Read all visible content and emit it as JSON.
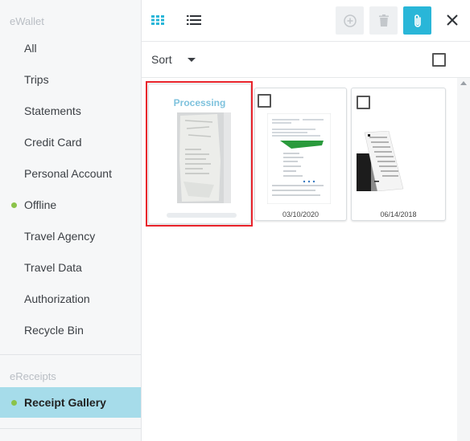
{
  "sidebar": {
    "ewallet_title": "eWallet",
    "items": [
      {
        "label": "All"
      },
      {
        "label": "Trips"
      },
      {
        "label": "Statements"
      },
      {
        "label": "Credit Card"
      },
      {
        "label": "Personal Account"
      },
      {
        "label": "Offline"
      },
      {
        "label": "Travel Agency"
      },
      {
        "label": "Travel Data"
      },
      {
        "label": "Authorization"
      },
      {
        "label": "Recycle Bin"
      }
    ],
    "ereceipts_title": "eReceipts",
    "receipt_gallery": "Receipt Gallery"
  },
  "toolbar": {
    "grid_view_icon": "grid-view-icon",
    "list_view_icon": "list-view-icon",
    "add_icon": "plus-circle-icon",
    "delete_icon": "trash-icon",
    "attach_icon": "paperclip-icon",
    "close_icon": "close-icon"
  },
  "sort": {
    "label": "Sort"
  },
  "cards": [
    {
      "status": "Processing",
      "date": ""
    },
    {
      "status": "",
      "date": "03/10/2020"
    },
    {
      "status": "",
      "date": "06/14/2018"
    }
  ],
  "colors": {
    "accent": "#29b6d8",
    "active_bg": "#a6dcea",
    "online_dot": "#8bc34a",
    "highlight": "#e8232b",
    "processing_text": "#7ec2dd"
  }
}
